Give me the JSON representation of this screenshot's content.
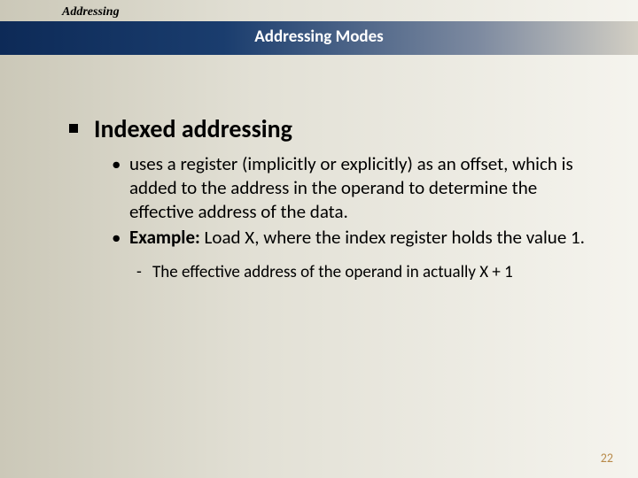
{
  "header": {
    "chapter": "Addressing",
    "title": "Addressing Modes"
  },
  "content": {
    "heading": "Indexed addressing",
    "bullets": [
      {
        "text": "uses a register (implicitly or explicitly) as an offset, which is added to the address in the operand to determine the effective address of the data."
      },
      {
        "label": "Example:",
        "text": " Load X, where the index register holds the value 1."
      }
    ],
    "sub": "The effective address of the operand in actually X + 1"
  },
  "page_number": "22"
}
